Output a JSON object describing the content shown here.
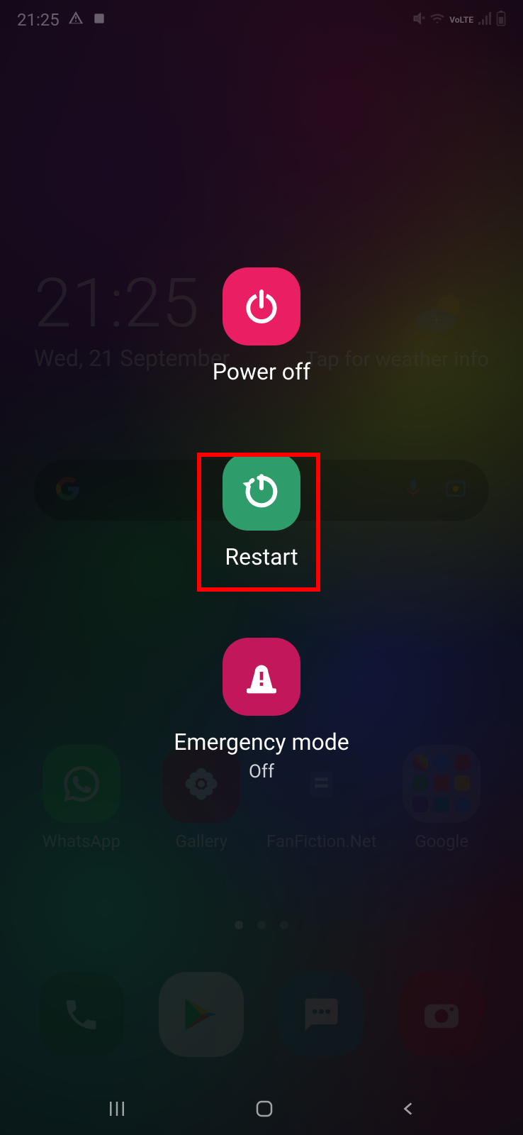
{
  "status_bar": {
    "time": "21:25"
  },
  "home": {
    "clock_time": "21:25",
    "clock_date": "Wed, 21 September",
    "weather_prompt": "Tap for weather info",
    "apps": [
      {
        "label": "WhatsApp"
      },
      {
        "label": "Gallery"
      },
      {
        "label": "FanFiction.Net"
      },
      {
        "label": "Google"
      }
    ]
  },
  "power_menu": {
    "options": [
      {
        "label": "Power off"
      },
      {
        "label": "Restart"
      },
      {
        "label": "Emergency mode",
        "sublabel": "Off"
      }
    ],
    "highlighted_index": 1
  }
}
